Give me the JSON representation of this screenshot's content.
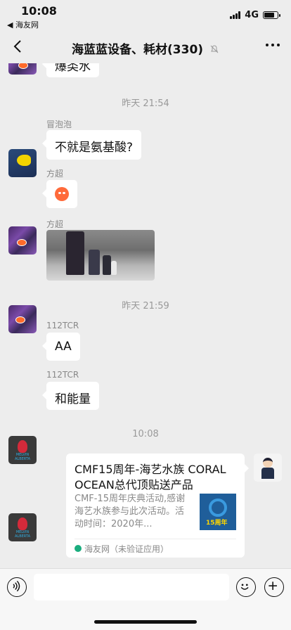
{
  "status": {
    "time": "10:08",
    "back_app": "◀ 海友网",
    "network": "4G",
    "battery_level": 0.8
  },
  "nav": {
    "title": "海蓝蓝设备、耗材(330)"
  },
  "messages": {
    "top_partial_text": "爆类水",
    "time1": "昨天 21:54",
    "sender_maopaopao": "冒泡泡",
    "text_amino": "不就是氨基酸?",
    "sender_fangchao_1": "方超",
    "sender_fangchao_2": "方超",
    "time2": "昨天 21:59",
    "sender_112tcr_1": "112TCR",
    "text_aa": "AA",
    "sender_112tcr_2": "112TCR",
    "text_energy": "和能量",
    "time3": "10:08"
  },
  "card": {
    "title": "CMF15周年-海艺水族 CORAL OCEAN总代顶贴送产品",
    "desc": "CMF-15周年庆典活动,感谢海艺水族参与此次活动。活动时间：2020年...",
    "source": "海友网（未验证应用）"
  },
  "icons": {
    "back": "chevron-left-icon",
    "mute": "bell-off-icon",
    "more": "more-icon",
    "voice": "voice-icon",
    "emoji": "emoji-icon",
    "plus": "plus-icon"
  }
}
